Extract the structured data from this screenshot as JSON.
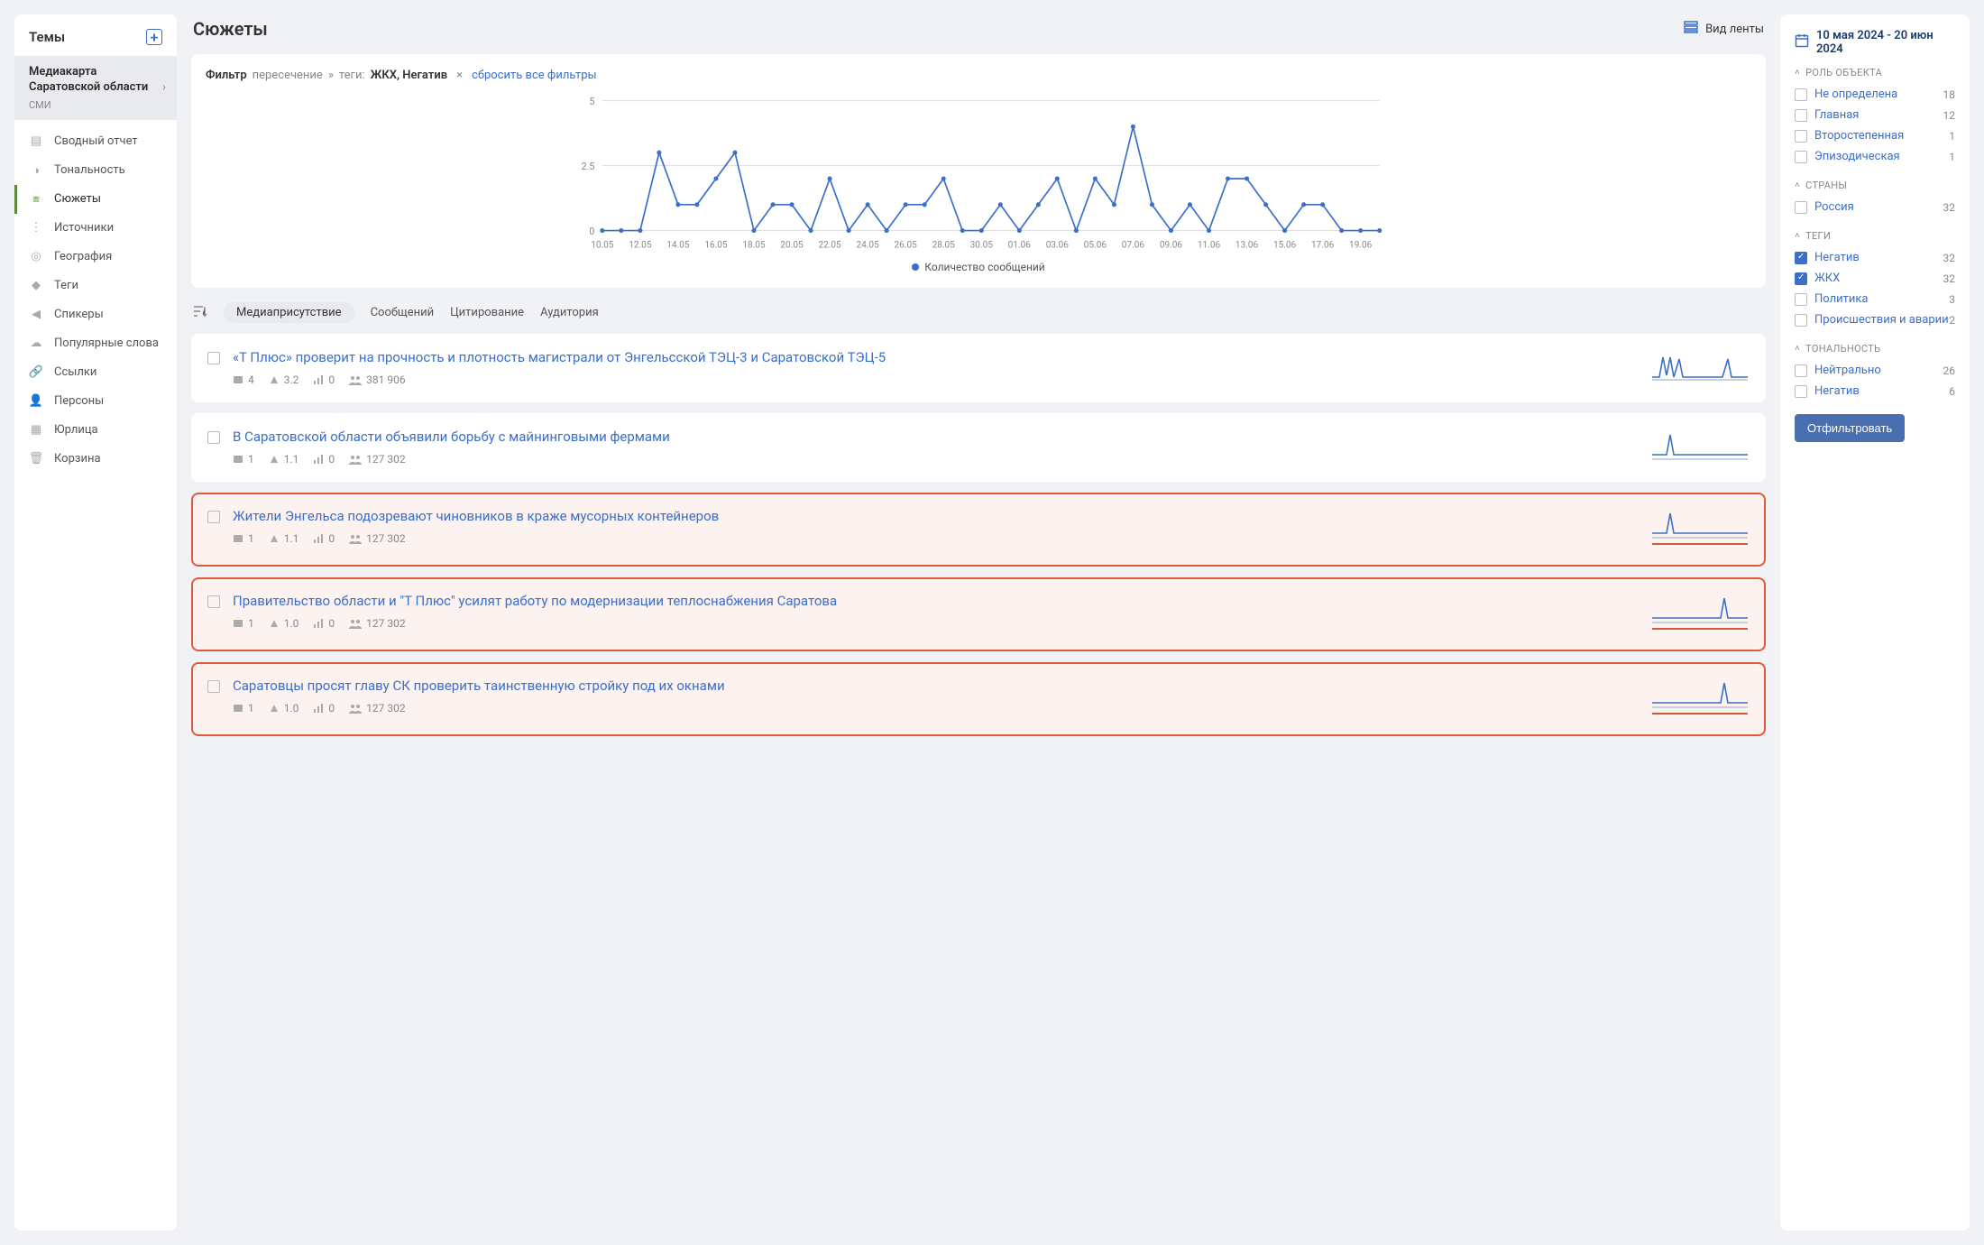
{
  "sidebar": {
    "header": "Темы",
    "theme_title": "Медиакарта Саратовской области",
    "theme_sub": "СМИ",
    "nav": [
      "Сводный отчет",
      "Тональность",
      "Сюжеты",
      "Источники",
      "География",
      "Теги",
      "Спикеры",
      "Популярные слова",
      "Ссылки",
      "Персоны",
      "Юрлица",
      "Корзина"
    ]
  },
  "main": {
    "title": "Сюжеты",
    "feed_toggle": "Вид ленты",
    "filter": {
      "label": "Фильтр",
      "mode": "пересечение",
      "sep": "»",
      "tags_label": "теги:",
      "tags": "ЖКХ, Негатив",
      "clear": "сбросить все фильтры"
    },
    "chart_legend": "Количество сообщений",
    "tabs": [
      "Медиаприсутствие",
      "Сообщений",
      "Цитирование",
      "Аудитория"
    ],
    "stories": [
      {
        "title": "«Т Плюс» проверит на прочность и плотность магистрали от Энгельсской ТЭЦ-3 и Саратовской ТЭЦ-5",
        "m1": "4",
        "m2": "3.2",
        "m3": "0",
        "m4": "381 906",
        "neg": false,
        "spark": "multi"
      },
      {
        "title": "В Саратовской области объявили борьбу с майнинговыми фермами",
        "m1": "1",
        "m2": "1.1",
        "m3": "0",
        "m4": "127 302",
        "neg": false,
        "spark": "single-left"
      },
      {
        "title": "Жители Энгельса подозревают чиновников в краже мусорных контейнеров",
        "m1": "1",
        "m2": "1.1",
        "m3": "0",
        "m4": "127 302",
        "neg": true,
        "spark": "single-left"
      },
      {
        "title": "Правительство области и \"Т Плюс\" усилят работу по модернизации теплоснабжения Саратова",
        "m1": "1",
        "m2": "1.0",
        "m3": "0",
        "m4": "127 302",
        "neg": true,
        "spark": "single-right"
      },
      {
        "title": "Саратовцы просят главу СК проверить таинственную стройку под их окнами",
        "m1": "1",
        "m2": "1.0",
        "m3": "0",
        "m4": "127 302",
        "neg": true,
        "spark": "single-right"
      }
    ]
  },
  "right": {
    "date_range": "10 мая 2024 - 20 июн 2024",
    "facets": [
      {
        "title": "РОЛЬ ОБЪЕКТА",
        "items": [
          {
            "label": "Не определена",
            "count": 18,
            "checked": false
          },
          {
            "label": "Главная",
            "count": 12,
            "checked": false
          },
          {
            "label": "Второстепенная",
            "count": 1,
            "checked": false
          },
          {
            "label": "Эпизодическая",
            "count": 1,
            "checked": false
          }
        ]
      },
      {
        "title": "СТРАНЫ",
        "items": [
          {
            "label": "Россия",
            "count": 32,
            "checked": false
          }
        ]
      },
      {
        "title": "ТЕГИ",
        "items": [
          {
            "label": "Негатив",
            "count": 32,
            "checked": true
          },
          {
            "label": "ЖКХ",
            "count": 32,
            "checked": true
          },
          {
            "label": "Политика",
            "count": 3,
            "checked": false
          },
          {
            "label": "Происшествия и аварии",
            "count": 2,
            "checked": false
          }
        ]
      },
      {
        "title": "ТОНАЛЬНОСТЬ",
        "items": [
          {
            "label": "Нейтрально",
            "count": 26,
            "checked": false
          },
          {
            "label": "Негатив",
            "count": 6,
            "checked": false
          }
        ]
      }
    ],
    "apply_btn": "Отфильтровать"
  },
  "chart_data": {
    "type": "line",
    "x_ticks": [
      "10.05",
      "12.05",
      "14.05",
      "16.05",
      "18.05",
      "20.05",
      "22.05",
      "24.05",
      "26.05",
      "28.05",
      "30.05",
      "01.06",
      "03.06",
      "05.06",
      "07.06",
      "09.06",
      "11.06",
      "13.06",
      "15.06",
      "17.06",
      "19.06"
    ],
    "title": "",
    "xlabel": "",
    "ylabel": "",
    "ylim": [
      0,
      5
    ],
    "y_ticks": [
      0,
      2.5,
      5
    ],
    "series": [
      {
        "name": "Количество сообщений",
        "color": "#3b6fc9",
        "x": [
          "10.05",
          "11.05",
          "12.05",
          "13.05",
          "14.05",
          "15.05",
          "16.05",
          "17.05",
          "18.05",
          "19.05",
          "20.05",
          "21.05",
          "22.05",
          "23.05",
          "24.05",
          "25.05",
          "26.05",
          "27.05",
          "28.05",
          "29.05",
          "30.05",
          "31.05",
          "01.06",
          "02.06",
          "03.06",
          "04.06",
          "05.06",
          "06.06",
          "07.06",
          "08.06",
          "09.06",
          "10.06",
          "11.06",
          "12.06",
          "13.06",
          "14.06",
          "15.06",
          "16.06",
          "17.06",
          "18.06",
          "19.06",
          "20.06"
        ],
        "values": [
          0,
          0,
          0,
          3,
          1,
          1,
          2,
          3,
          0,
          1,
          1,
          0,
          2,
          0,
          1,
          0,
          1,
          1,
          2,
          0,
          0,
          1,
          0,
          1,
          2,
          0,
          2,
          1,
          4,
          1,
          0,
          1,
          0,
          2,
          2,
          1,
          0,
          1,
          1,
          0,
          0,
          0
        ]
      }
    ]
  }
}
